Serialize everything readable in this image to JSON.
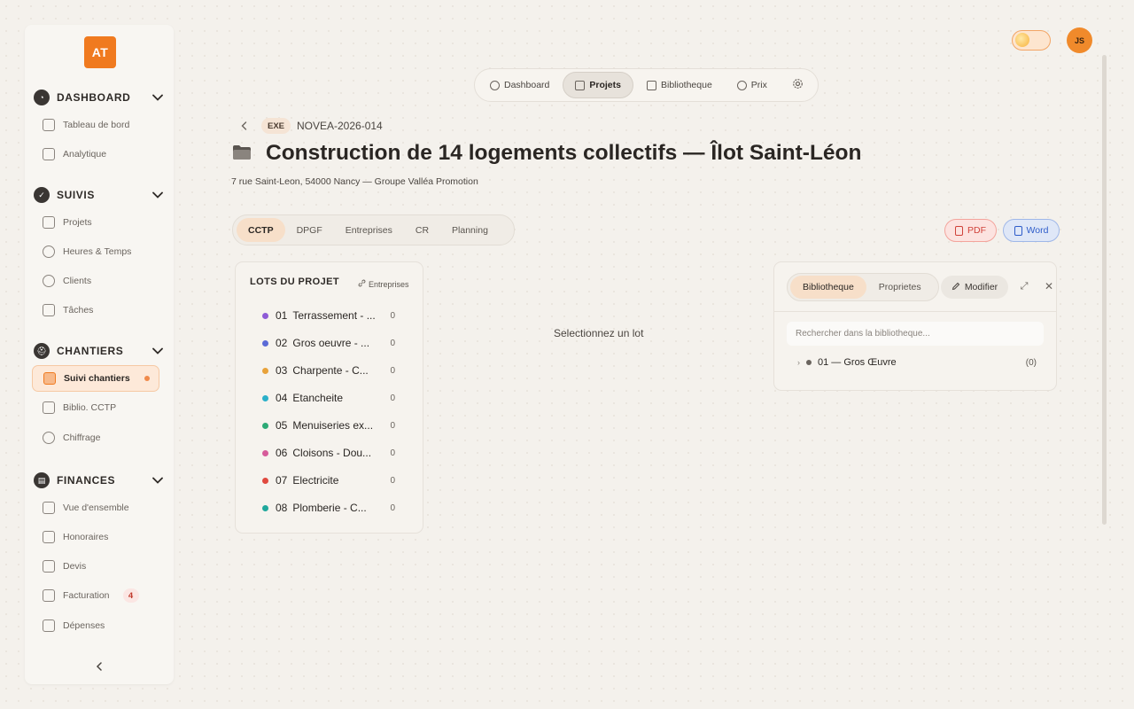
{
  "sidebar": {
    "logo": "AT",
    "sections": [
      {
        "label": "DASHBOARD",
        "items": [
          {
            "label": "Tableau de bord"
          },
          {
            "label": "Analytique"
          }
        ]
      },
      {
        "label": "SUIVIS",
        "items": [
          {
            "label": "Projets"
          },
          {
            "label": "Heures & Temps"
          },
          {
            "label": "Clients"
          },
          {
            "label": "Tâches"
          }
        ]
      },
      {
        "label": "CHANTIERS",
        "items": [
          {
            "label": "Suivi chantiers"
          },
          {
            "label": "Biblio. CCTP"
          },
          {
            "label": "Chiffrage"
          }
        ]
      },
      {
        "label": "FINANCES",
        "items": [
          {
            "label": "Vue d'ensemble"
          },
          {
            "label": "Honoraires"
          },
          {
            "label": "Devis"
          },
          {
            "label": "Facturation",
            "badge": "4"
          },
          {
            "label": "Dépenses"
          }
        ]
      }
    ],
    "collapse_icon": "chevron-left-icon"
  },
  "topbar": {
    "avatar": "JS",
    "theme_toggle": "sun-toggle"
  },
  "topnav": {
    "items": [
      {
        "label": "Dashboard",
        "icon": "home-icon"
      },
      {
        "label": "Projets",
        "icon": "building-icon"
      },
      {
        "label": "Bibliotheque",
        "icon": "book-icon"
      },
      {
        "label": "Prix",
        "icon": "coins-icon"
      }
    ],
    "settings_icon": "gear-icon",
    "active": "Projets"
  },
  "project": {
    "phase": "EXE",
    "code": "NOVEA-2026-014",
    "title": "Construction de 14 logements collectifs — Îlot Saint-Léon",
    "subtitle": "7 rue Saint-Leon, 54000 Nancy — Groupe Valléa Promotion"
  },
  "tabs": {
    "items": [
      "CCTP",
      "DPGF",
      "Entreprises",
      "CR",
      "Planning"
    ],
    "active": "CCTP"
  },
  "export": {
    "pdf_label": "PDF",
    "word_label": "Word",
    "pdf_color": "#d0423a",
    "word_color": "#2e5cc9"
  },
  "lots": {
    "title": "LOTS DU PROJET",
    "link_label": "Entreprises",
    "items": [
      {
        "num": "01",
        "name": "Terrassement - ...",
        "count": "0",
        "color": "#8e5bd6"
      },
      {
        "num": "02",
        "name": "Gros oeuvre - ...",
        "count": "0",
        "color": "#5b6ad6"
      },
      {
        "num": "03",
        "name": "Charpente - C...",
        "count": "0",
        "color": "#e8a23a"
      },
      {
        "num": "04",
        "name": "Etancheite",
        "count": "0",
        "color": "#2bb0c9"
      },
      {
        "num": "05",
        "name": "Menuiseries ex...",
        "count": "0",
        "color": "#2daa76"
      },
      {
        "num": "06",
        "name": "Cloisons - Dou...",
        "count": "0",
        "color": "#d65b9a"
      },
      {
        "num": "07",
        "name": "Electricite",
        "count": "0",
        "color": "#e0493e"
      },
      {
        "num": "08",
        "name": "Plomberie - C...",
        "count": "0",
        "color": "#20a89c"
      }
    ]
  },
  "main": {
    "empty_message": "Selectionnez un lot"
  },
  "library": {
    "tabs": [
      "Bibliotheque",
      "Proprietes"
    ],
    "active_tab": "Bibliotheque",
    "edit_label": "Modifier",
    "search_placeholder": "Rechercher dans la bibliotheque...",
    "tree": [
      {
        "label": "01 — Gros Œuvre",
        "count": "(0)"
      }
    ]
  }
}
